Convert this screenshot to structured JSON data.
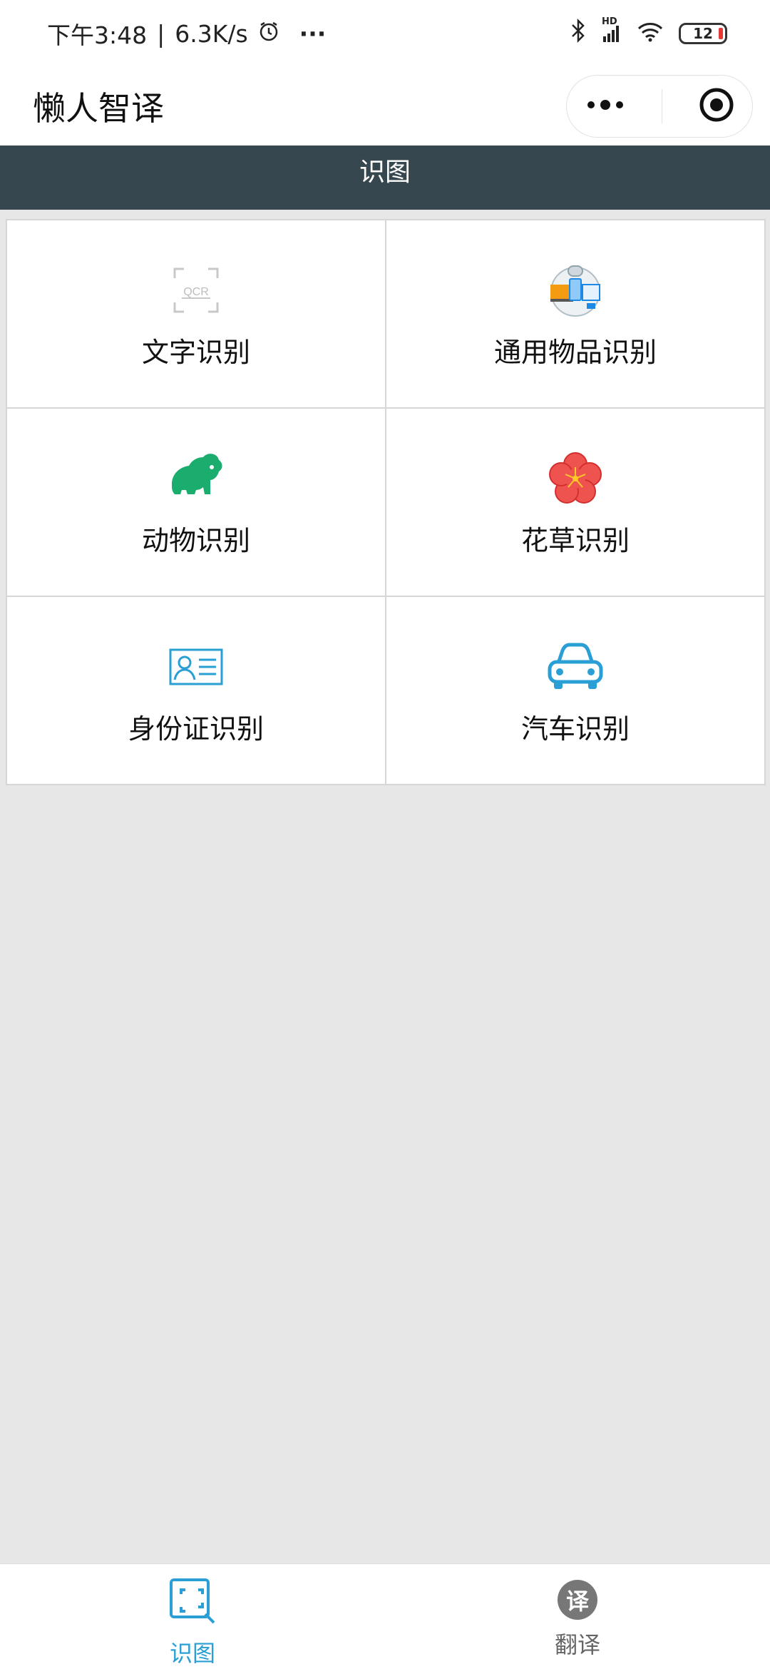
{
  "status_bar": {
    "time": "下午3:48",
    "speed": "6.3K/s",
    "separator": "|",
    "more": "···",
    "network": "HD",
    "battery": "12"
  },
  "app": {
    "title": "懒人智译"
  },
  "section": {
    "title": "识图"
  },
  "features": [
    {
      "label": "文字识别",
      "icon": "ocr-icon"
    },
    {
      "label": "通用物品识别",
      "icon": "general-object-icon"
    },
    {
      "label": "动物识别",
      "icon": "koala-icon"
    },
    {
      "label": "花草识别",
      "icon": "flower-icon"
    },
    {
      "label": "身份证识别",
      "icon": "id-card-icon"
    },
    {
      "label": "汽车识别",
      "icon": "car-icon"
    }
  ],
  "ocr_icon_text": "QCR",
  "tabs": [
    {
      "label": "识图",
      "icon": "scan-search-icon",
      "active": true
    },
    {
      "label": "翻译",
      "icon": "translate-icon",
      "active": false,
      "badge": "译"
    }
  ],
  "colors": {
    "header_bg": "#37474f",
    "accent": "#2a9fd6",
    "animal_green": "#1aad6e",
    "flower_red": "#ef5350",
    "page_bg": "#e7e7e7"
  }
}
